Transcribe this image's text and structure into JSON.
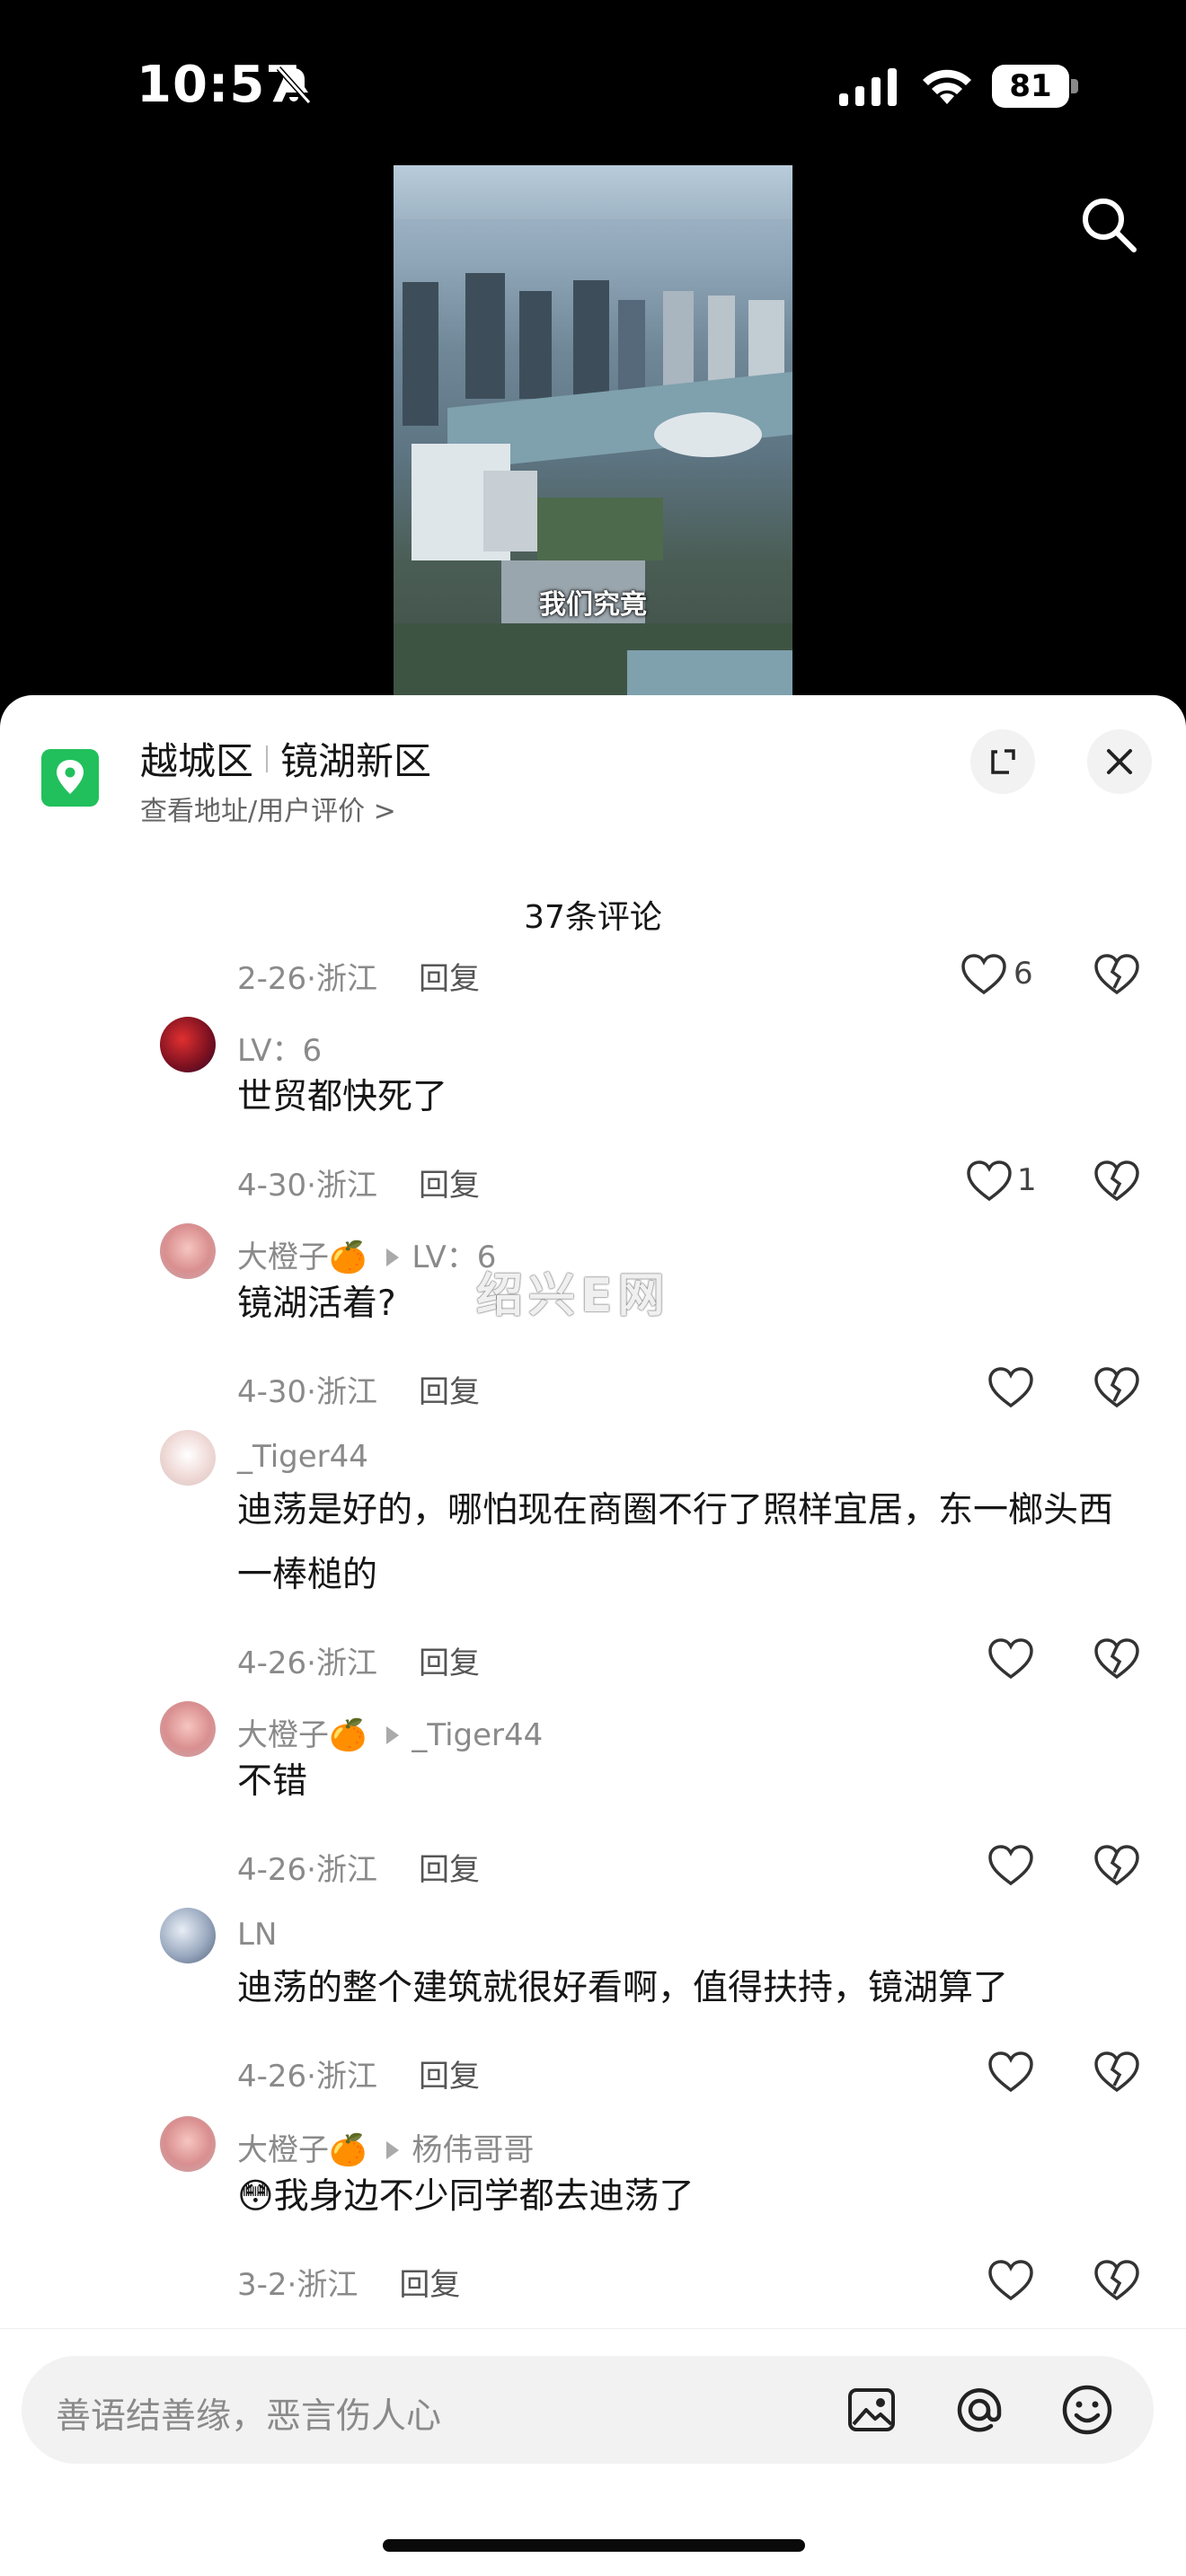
{
  "status": {
    "time": "10:57",
    "battery": "81"
  },
  "video": {
    "caption": "我们究竟"
  },
  "location": {
    "district": "越城区",
    "area": "镜湖新区",
    "subtitle": "查看地址/用户评价 >"
  },
  "comment_count": "37条评论",
  "watermark": "绍兴E网",
  "comments": [
    {
      "user": "",
      "reply_to": "",
      "text": "",
      "date": "2-26·浙江",
      "reply": "回复",
      "likes": "6",
      "avatar": "none"
    },
    {
      "user": "LV：6",
      "reply_to": "",
      "text": "世贸都快死了",
      "date": "4-30·浙江",
      "reply": "回复",
      "likes": "1",
      "avatar": "red"
    },
    {
      "user": "大橙子🍊",
      "reply_to": "LV：6",
      "text": "镜湖活着?",
      "date": "4-30·浙江",
      "reply": "回复",
      "likes": "",
      "avatar": "pink"
    },
    {
      "user": "_Tiger44",
      "reply_to": "",
      "text": "迪荡是好的，哪怕现在商圈不行了照样宜居，东一榔头西一棒槌的",
      "date": "4-26·浙江",
      "reply": "回复",
      "likes": "",
      "avatar": "light"
    },
    {
      "user": "大橙子🍊",
      "reply_to": "_Tiger44",
      "text": "不错",
      "date": "4-26·浙江",
      "reply": "回复",
      "likes": "",
      "avatar": "pink"
    },
    {
      "user": "LN",
      "reply_to": "",
      "text": "迪荡的整个建筑就很好看啊，值得扶持，镜湖算了",
      "date": "4-26·浙江",
      "reply": "回复",
      "likes": "",
      "avatar": "blue"
    },
    {
      "user": "大橙子🍊",
      "reply_to": "杨伟哥哥",
      "text": "😳我身边不少同学都去迪荡了",
      "date": "3-2·浙江",
      "reply": "回复",
      "likes": "",
      "avatar": "pink"
    }
  ],
  "input": {
    "placeholder": "善语结善缘，恶言伤人心"
  },
  "icons": [
    "bell-slash-icon",
    "signal-icon",
    "wifi-icon",
    "battery-icon",
    "search-icon",
    "location-pin-icon",
    "expand-icon",
    "close-icon",
    "heart-icon",
    "broken-heart-icon",
    "image-icon",
    "at-icon",
    "emoji-icon"
  ]
}
